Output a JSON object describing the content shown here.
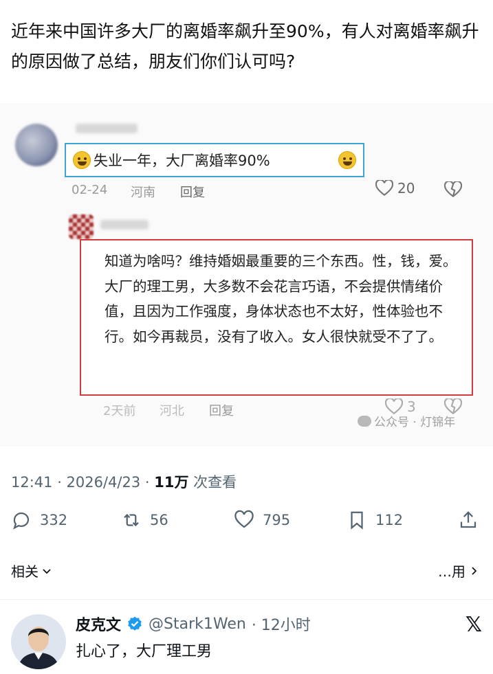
{
  "post": {
    "text": "近年来中国许多大厂的离婚率飙升至90%，有人对离婚率飙升的原因做了总结，朋友们你们认可吗?"
  },
  "screenshot": {
    "comment1": {
      "text": "失业一年，大厂离婚率90%",
      "date": "02-24",
      "location": "河南",
      "reply_label": "回复",
      "likes": "20"
    },
    "comment2": {
      "text": "知道为啥吗？维持婚姻最重要的三个东西。性，钱，爱。大厂的理工男，大多数不会花言巧语，不会提供情绪价值，且因为工作强度，身体状态也不太好，性体验也不行。如今再裁员，没有了收入。女人很快就受不了了。",
      "date": "2天前",
      "location": "河北",
      "reply_label": "回复",
      "likes": "3"
    },
    "watermark": "公众号 · 灯锦年"
  },
  "meta": {
    "time": "12:41 · 2026/4/23 · ",
    "views_count": "11万",
    "views_label": " 次查看"
  },
  "actions": {
    "replies": "332",
    "reposts": "56",
    "likes": "795",
    "bookmarks": "112"
  },
  "related": {
    "label": "相关",
    "right_label": "…用"
  },
  "reply": {
    "name": "皮克文",
    "handle": "@Stark1Wen",
    "time": "· 12小时",
    "text": "扎心了，大厂理工男"
  },
  "colors": {
    "accent_blue": "#1d9bf0",
    "box_blue": "#3fa3d8",
    "box_red": "#d23c3c",
    "muted": "#536471"
  }
}
